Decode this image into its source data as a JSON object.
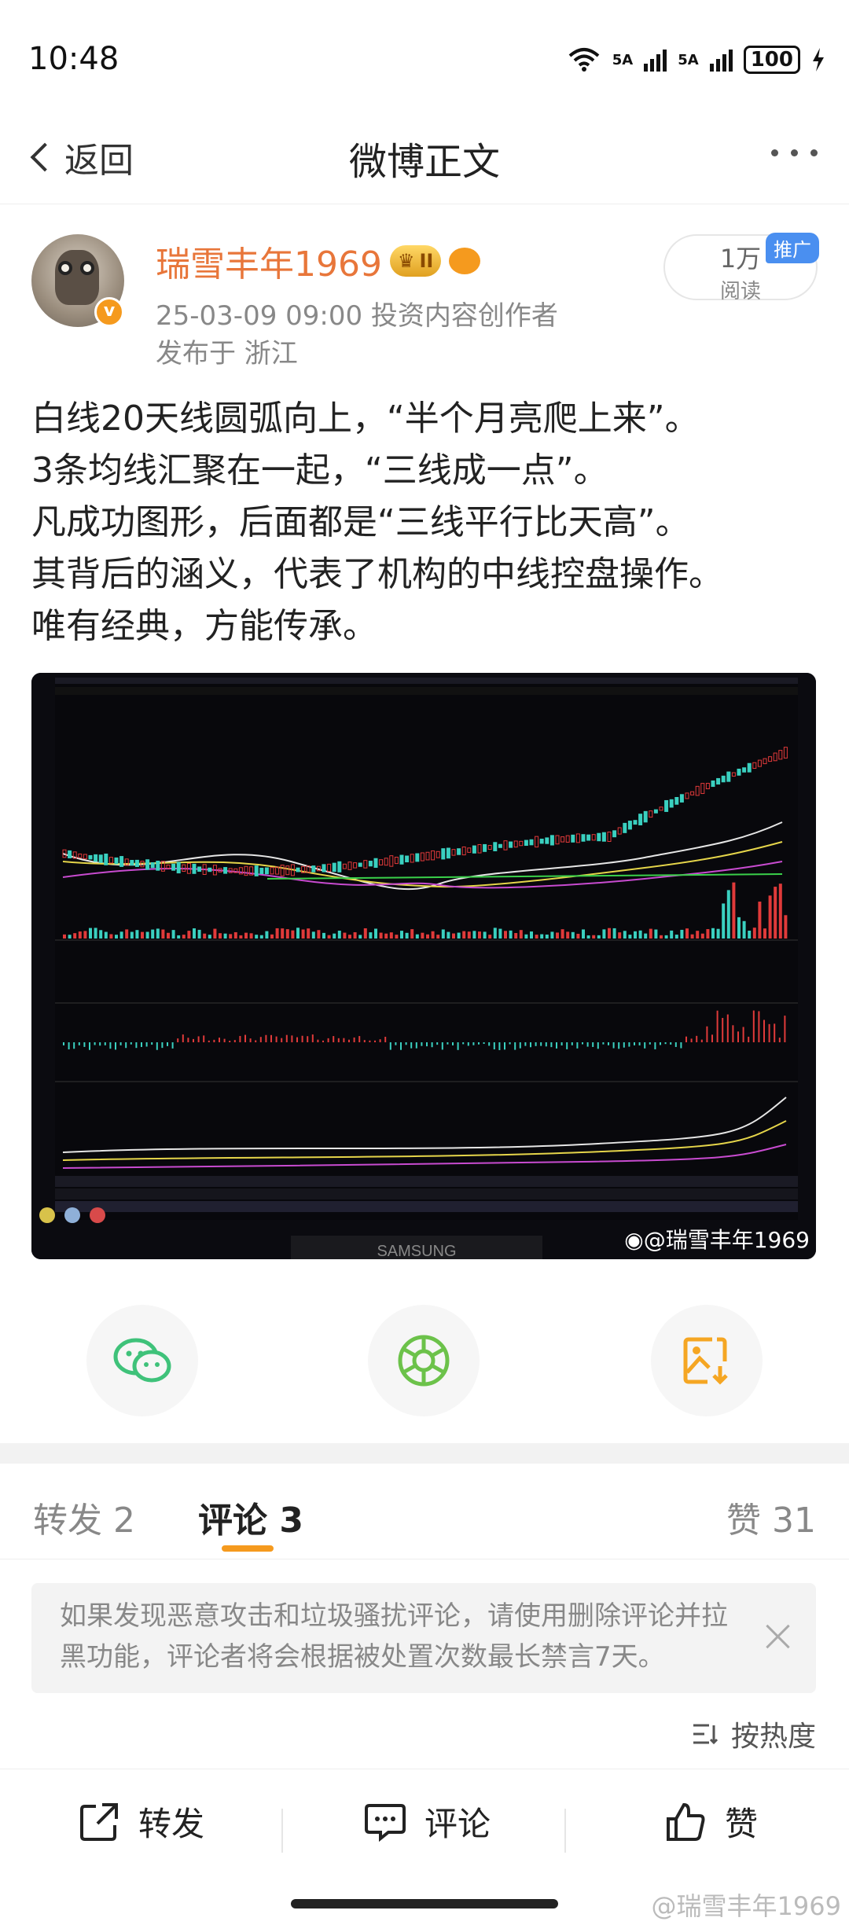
{
  "status": {
    "time": "10:48",
    "net1": "5A",
    "net2": "5A",
    "battery": "100"
  },
  "nav": {
    "back_label": "返回",
    "title": "微博正文"
  },
  "author": {
    "name": "瑞雪丰年1969",
    "level_badge": "II",
    "verified_mark": "v",
    "meta": "25-03-09 09:00  投资内容创作者",
    "location": "发布于 浙江"
  },
  "reads": {
    "count": "1万",
    "label": "阅读",
    "promo": "推广"
  },
  "post": {
    "lines": [
      "白线20天线圆弧向上，“半个月亮爬上来”。",
      "3条均线汇聚在一起，“三线成一点”。",
      "凡成功图形，后面都是“三线平行比天高”。",
      "其背后的涵义，代表了机构的中线控盘操作。",
      "唯有经典，方能传承。"
    ],
    "image_watermark": "@瑞雪丰年1969",
    "image_brand": "SAMSUNG"
  },
  "share_icons": [
    "wechat-icon",
    "moments-icon",
    "save-image-icon"
  ],
  "tabs": {
    "repost": "转发 2",
    "comment": "评论 3",
    "like": "赞 31"
  },
  "notice": "如果发现恶意攻击和垃圾骚扰评论，请使用删除评论并拉黑功能，评论者将会根据被处置次数最长禁言7天。",
  "sort_label": "按热度",
  "bottom": {
    "repost": "转发",
    "comment": "评论",
    "like": "赞"
  },
  "page_watermark": "@瑞雪丰年1969",
  "colors": {
    "accent": "#f59a1e",
    "username": "#e8763a",
    "promo": "#4a8ff0",
    "wechat": "#3fc27a"
  }
}
